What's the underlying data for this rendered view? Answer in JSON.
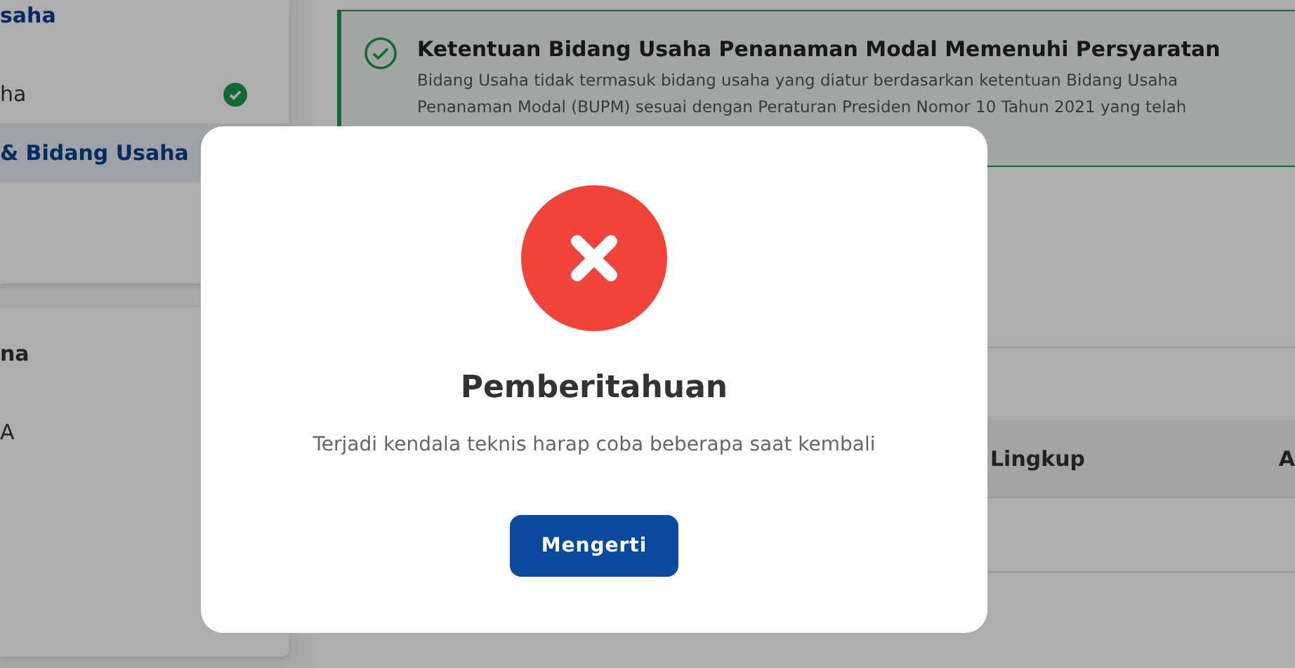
{
  "sidebar": {
    "cards": [
      {
        "title": "saha",
        "items": [
          {
            "label": "ha",
            "done": true,
            "selected": false
          },
          {
            "label": "& Bidang Usaha",
            "done": false,
            "selected": true
          }
        ]
      },
      {
        "title": "na",
        "items": [
          {
            "label": "A",
            "selected": false
          }
        ]
      }
    ]
  },
  "alert": {
    "kind": "success",
    "title": "Ketentuan Bidang Usaha Penanaman Modal Memenuhi Persyaratan",
    "body": "Bidang Usaha tidak termasuk bidang usaha yang diatur berdasarkan ketentuan Bidang Usaha\nPenanaman Modal (BUPM) sesuai dengan Peraturan Presiden Nomor 10 Tahun 2021 yang telah"
  },
  "table": {
    "columns": [
      "Lingkup",
      "A"
    ]
  },
  "modal": {
    "kind": "error",
    "title": "Pemberitahuan",
    "message": "Terjadi kendala teknis harap coba beberapa saat kembali",
    "button": "Mengerti"
  }
}
